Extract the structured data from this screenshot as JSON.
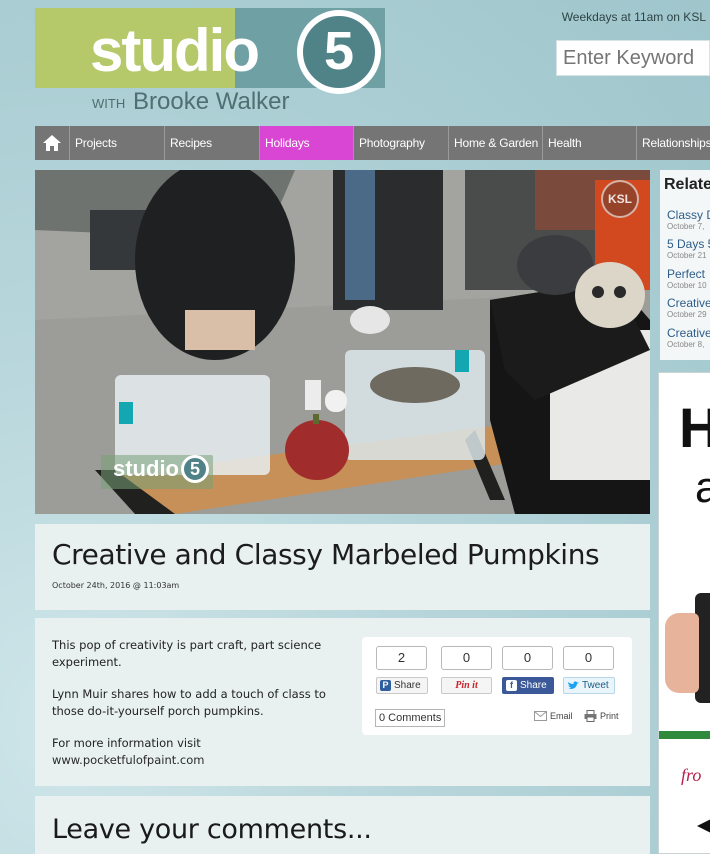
{
  "header": {
    "logo_word": "studio",
    "logo_number": "5",
    "logo_with": "WITH",
    "logo_host": "Brooke Walker",
    "schedule": "Weekdays at 11am on KSL",
    "search_placeholder": "Enter Keyword"
  },
  "nav": {
    "items": [
      "Projects",
      "Recipes",
      "Holidays",
      "Photography",
      "Home & Garden",
      "Health",
      "Relationships"
    ],
    "active": "Holidays"
  },
  "video": {
    "watermark_word": "studio",
    "watermark_number": "5",
    "channel_bug": "KSL"
  },
  "related": {
    "heading": "Relate",
    "items": [
      {
        "title": "Classy D",
        "date": "October 7,"
      },
      {
        "title": "5 Days 5",
        "date": "October 21"
      },
      {
        "title": "Perfect",
        "date": "October 10"
      },
      {
        "title": "Creative",
        "date": "October 29"
      },
      {
        "title": "Creative",
        "date": "October 8,"
      }
    ]
  },
  "ad": {
    "big_letter": "H",
    "second_letter": "a",
    "footer_text": "fro"
  },
  "article": {
    "title": "Creative and Classy Marbeled Pumpkins",
    "date": "October 24th, 2016 @ 11:03am",
    "paragraphs": [
      "This pop of creativity is part craft, part science experiment.",
      "Lynn Muir shares how to add a touch of class to those do-it-yourself porch pumpkins.",
      "For more information visit"
    ],
    "link": "www.pocketfulofpaint.com"
  },
  "share": {
    "counts": [
      "2",
      "0",
      "0",
      "0"
    ],
    "buttons": [
      "Share",
      "Pin it",
      "Share",
      "Tweet"
    ],
    "comments_label": "0 Comments",
    "email_label": "Email",
    "print_label": "Print"
  },
  "comments_section": {
    "heading": "Leave your comments..."
  },
  "colors": {
    "nav": "#757575",
    "nav_active": "#d946d4",
    "logo_green": "#b5c86a",
    "logo_teal": "#6fa0a4"
  }
}
